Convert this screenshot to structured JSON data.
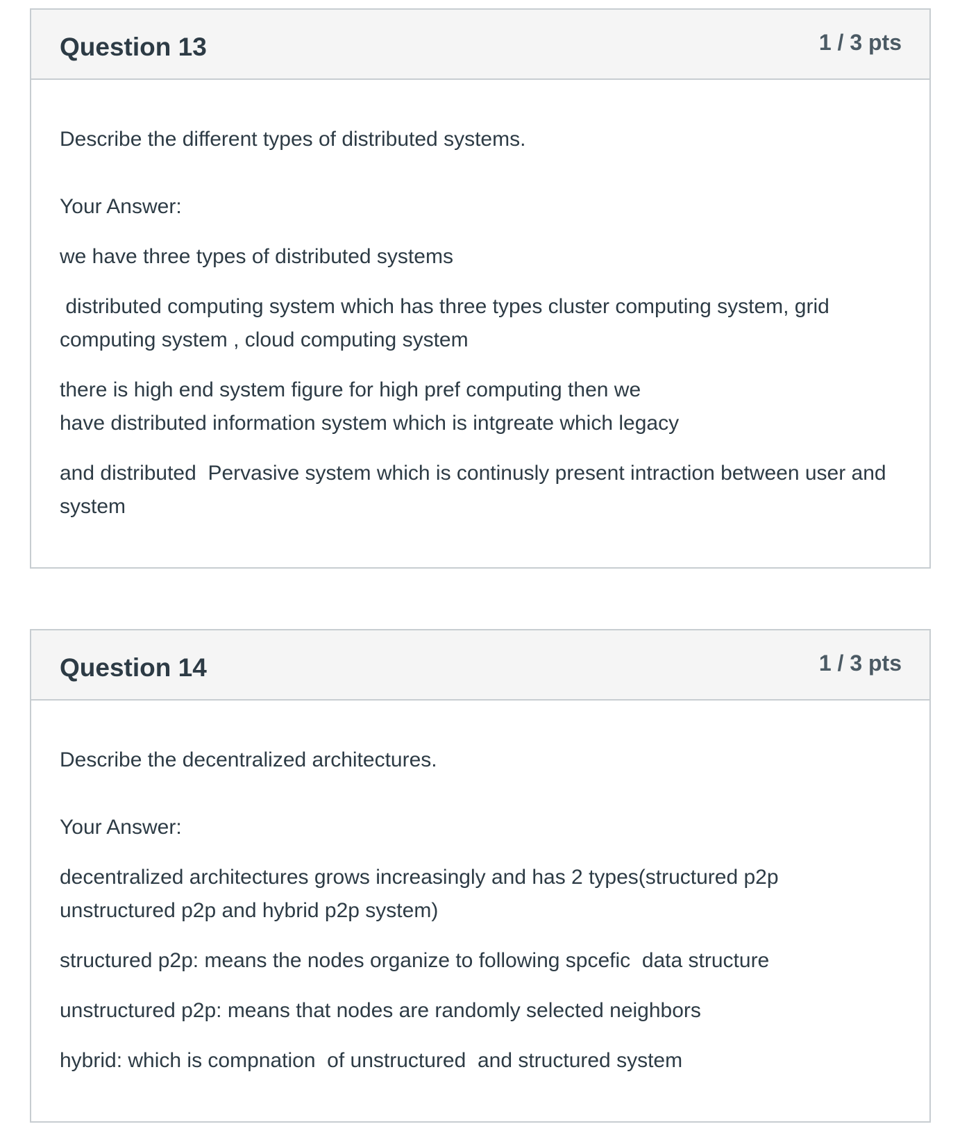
{
  "questions": [
    {
      "title": "Question 13",
      "points": "1 / 3 pts",
      "prompt": "Describe the different types of distributed systems.",
      "answer_label": "Your Answer:",
      "answer_paragraphs": [
        "we have three types of distributed systems",
        " distributed computing system which has three types cluster computing system, grid computing system , cloud computing system",
        "there is high end system figure for high pref computing then we\nhave distributed information system which is intgreate which legacy",
        "and distributed  Pervasive system which is continusly present intraction between user and system"
      ]
    },
    {
      "title": "Question 14",
      "points": "1 / 3 pts",
      "prompt": "Describe the decentralized architectures.",
      "answer_label": "Your Answer:",
      "answer_paragraphs": [
        "decentralized architectures grows increasingly and has 2 types(structured p2p unstructured p2p and hybrid p2p system)",
        "structured p2p: means the nodes organize to following spcefic  data structure",
        "unstructured p2p: means that nodes are randomly selected neighbors",
        "hybrid: which is compnation  of unstructured  and structured system"
      ]
    }
  ]
}
